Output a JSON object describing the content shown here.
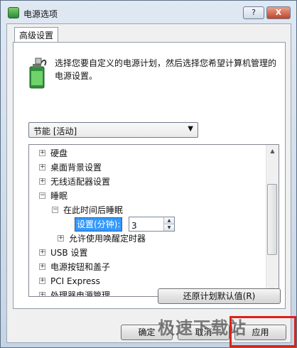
{
  "window": {
    "title": "电源选项",
    "help_label": "?",
    "close_label": "X"
  },
  "tab": {
    "label": "高级设置"
  },
  "description": "选择您要自定义的电源计划，然后选择您希望计算机管理的电源设置。",
  "plan_select": {
    "value": "节能 [活动]"
  },
  "tree": {
    "items": [
      {
        "label": "硬盘",
        "state": "+"
      },
      {
        "label": "桌面背景设置",
        "state": "+"
      },
      {
        "label": "无线适配器设置",
        "state": "+"
      },
      {
        "label": "睡眠",
        "state": "−"
      },
      {
        "label": "在此时间后睡眠",
        "state": "−"
      },
      {
        "label": "设置(分钟):",
        "value": "3"
      },
      {
        "label": "允许使用唤醒定时器",
        "state": "+"
      },
      {
        "label": "USB 设置",
        "state": "+"
      },
      {
        "label": "电源按钮和盖子",
        "state": "+"
      },
      {
        "label": "PCI Express",
        "state": "+"
      },
      {
        "label": "处理器电源管理",
        "state": "+"
      }
    ]
  },
  "restore_button": "还原计划默认值(R)",
  "ok_button": "确定",
  "cancel_button": "取消",
  "apply_button": "应用",
  "watermark": {
    "text": "极速下载站"
  }
}
